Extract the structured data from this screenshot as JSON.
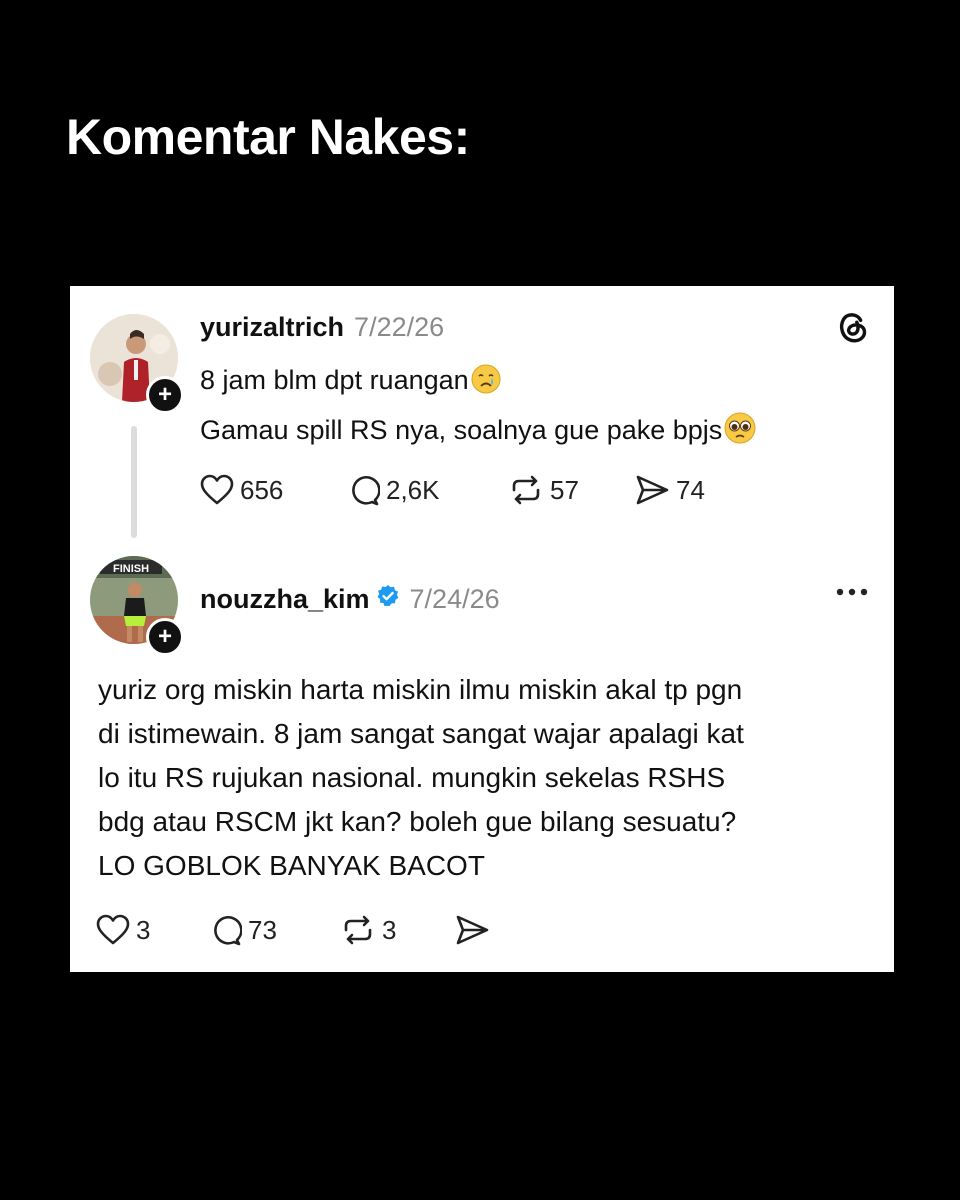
{
  "headline": "Komentar Nakes:",
  "post1": {
    "username": "yurizaltrich",
    "date": "7/22/26",
    "line1": "8 jam blm dpt ruangan",
    "line2": "Gamau spill RS nya, soalnya gue pake bpjs",
    "likes": "656",
    "replies": "2,6K",
    "reposts": "57",
    "shares": "74"
  },
  "post2": {
    "username": "nouzzha_kim",
    "date": "7/24/26",
    "avatar_badge_text": "FINISH",
    "body": [
      "yuriz org miskin harta miskin ilmu miskin akal tp pgn",
      "di istimewain. 8 jam sangat sangat wajar apalagi kat",
      "lo itu RS rujukan nasional. mungkin sekelas RSHS",
      "bdg atau RSCM jkt kan? boleh gue bilang sesuatu?",
      "LO GOBLOK BANYAK BACOT"
    ],
    "likes": "3",
    "replies": "73",
    "reposts": "3"
  },
  "icons": {
    "brand": "threads-icon",
    "like": "heart-icon",
    "reply": "comment-icon",
    "repost": "repost-icon",
    "share": "share-icon",
    "verified": "verified-badge-icon",
    "more": "more-icon"
  },
  "colors": {
    "verified": "#1d9bf0",
    "date": "#8a8a8a",
    "background": "#000000",
    "card": "#ffffff"
  }
}
